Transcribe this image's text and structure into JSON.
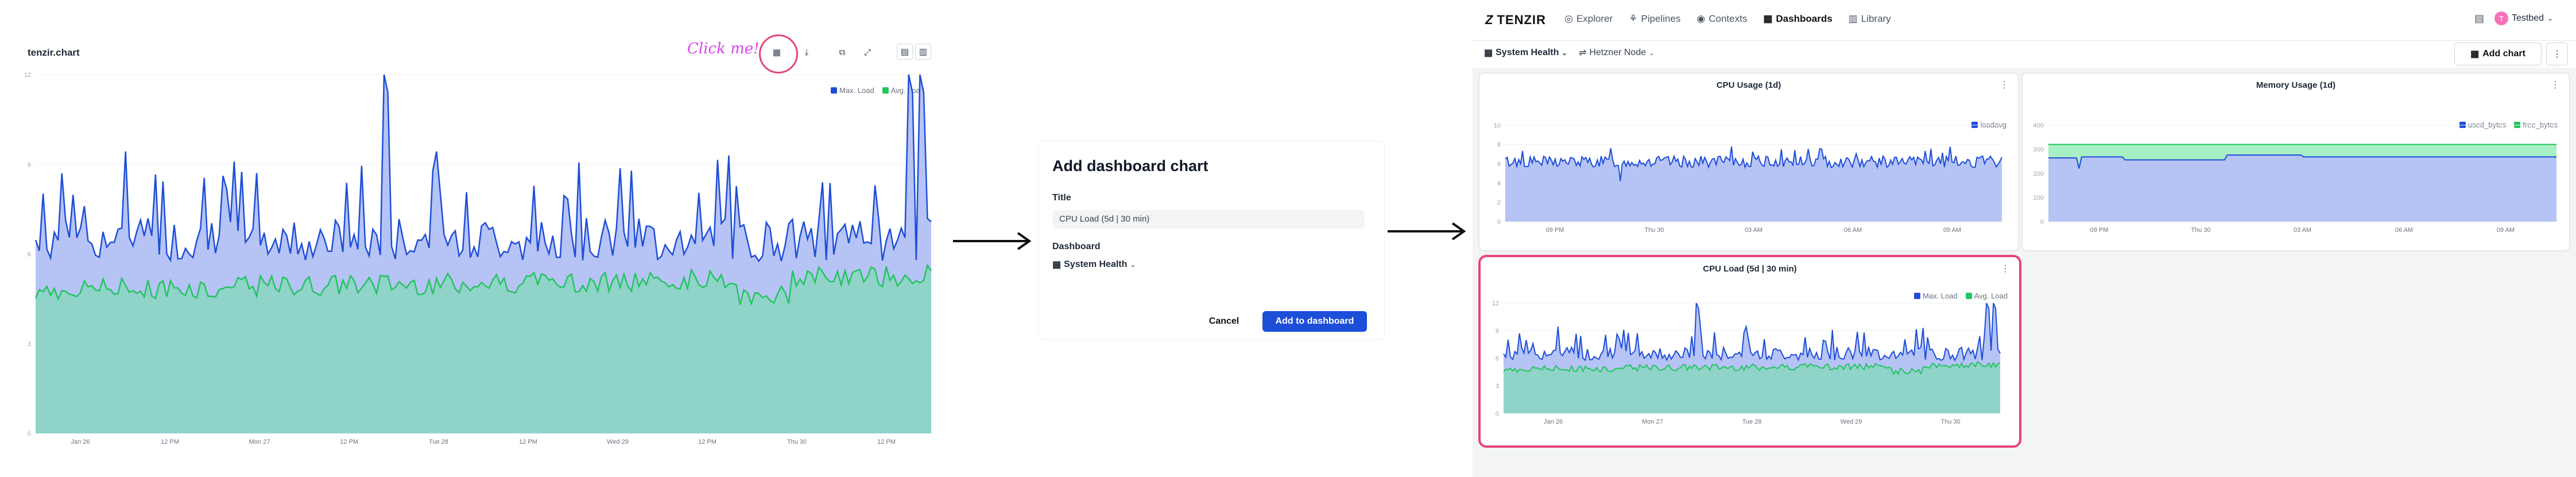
{
  "left": {
    "title": "tenzir.chart",
    "annotation": "Click me!",
    "legend": [
      {
        "label": "Max. Load",
        "color": "#1d4ed8"
      },
      {
        "label": "Avg. Load",
        "color": "#22c55e"
      }
    ],
    "y_ticks": [
      "0",
      "3",
      "6",
      "9",
      "12"
    ],
    "x_ticks": [
      "Jan 26",
      "12 PM",
      "Mon 27",
      "12 PM",
      "Tue 28",
      "12 PM",
      "Wed 29",
      "12 PM",
      "Thu 30",
      "12 PM"
    ]
  },
  "dialog": {
    "title": "Add dashboard chart",
    "title_label": "Title",
    "title_value": "CPU Load (5d | 30 min)",
    "dashboard_label": "Dashboard",
    "dashboard_value": "System Health",
    "cancel": "Cancel",
    "submit": "Add to dashboard"
  },
  "app": {
    "brand": "TENZIR",
    "nav": [
      "Explorer",
      "Pipelines",
      "Contexts",
      "Dashboards",
      "Library"
    ],
    "active_nav": "Dashboards",
    "user": "Testbed",
    "user_initial": "T",
    "dashboard_select": "System Health",
    "node_select": "Hetzner Node",
    "add_chart": "Add chart",
    "accent": "#e6437a"
  },
  "charts": [
    {
      "title": "CPU Usage (1d)",
      "legend": [
        {
          "label": "loadavg",
          "color": "#1d4ed8"
        }
      ],
      "y_ticks": [
        "0",
        "2",
        "4",
        "6",
        "8",
        "10"
      ],
      "x_ticks": [
        "09 PM",
        "Thu 30",
        "03 AM",
        "06 AM",
        "09 AM"
      ]
    },
    {
      "title": "Memory Usage (1d)",
      "legend": [
        {
          "label": "used_bytes",
          "color": "#1d4ed8"
        },
        {
          "label": "free_bytes",
          "color": "#22c55e"
        }
      ],
      "y_ticks": [
        "0",
        "100",
        "200",
        "300",
        "400"
      ],
      "x_ticks": [
        "09 PM",
        "Thu 30",
        "03 AM",
        "06 AM",
        "09 AM"
      ]
    },
    {
      "title": "CPU Load (5d | 30 min)",
      "legend": [
        {
          "label": "Max. Load",
          "color": "#1d4ed8"
        },
        {
          "label": "Avg. Load",
          "color": "#22c55e"
        }
      ],
      "y_ticks": [
        "0",
        "3",
        "6",
        "9",
        "12"
      ],
      "x_ticks": [
        "Jan 26",
        "Mon 27",
        "Tue 28",
        "Wed 29",
        "Thu 30"
      ]
    }
  ]
}
